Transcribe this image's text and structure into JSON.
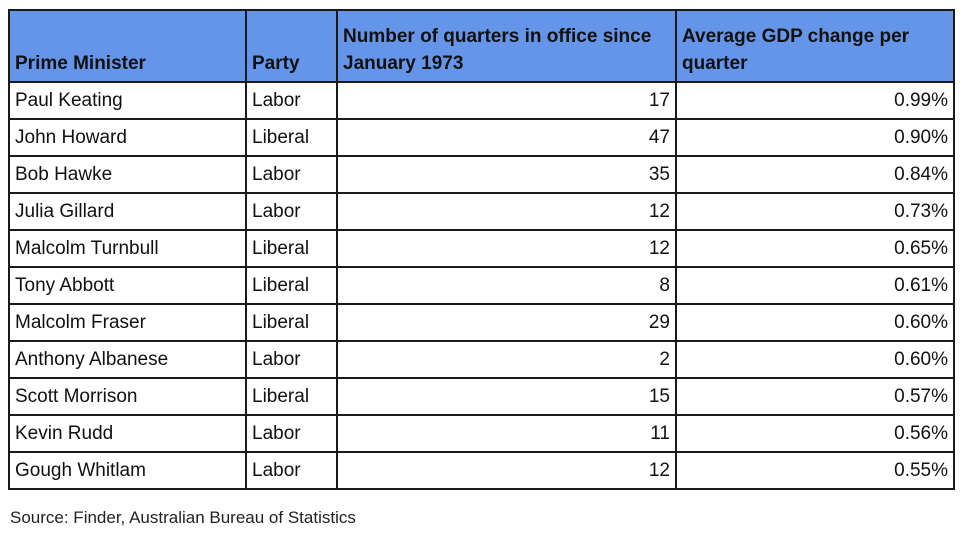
{
  "table": {
    "headers": [
      "Prime Minister",
      "Party",
      "Number of quarters in office since January 1973",
      "Average GDP change per quarter"
    ],
    "header_color": "#6495e8",
    "rows": [
      {
        "pm": "Paul Keating",
        "party": "Labor",
        "quarters": "17",
        "gdp": "0.99%"
      },
      {
        "pm": "John Howard",
        "party": "Liberal",
        "quarters": "47",
        "gdp": "0.90%"
      },
      {
        "pm": "Bob Hawke",
        "party": "Labor",
        "quarters": "35",
        "gdp": "0.84%"
      },
      {
        "pm": "Julia Gillard",
        "party": "Labor",
        "quarters": "12",
        "gdp": "0.73%"
      },
      {
        "pm": "Malcolm Turnbull",
        "party": "Liberal",
        "quarters": "12",
        "gdp": "0.65%"
      },
      {
        "pm": "Tony Abbott",
        "party": "Liberal",
        "quarters": "8",
        "gdp": "0.61%"
      },
      {
        "pm": "Malcolm Fraser",
        "party": "Liberal",
        "quarters": "29",
        "gdp": "0.60%"
      },
      {
        "pm": "Anthony Albanese",
        "party": "Labor",
        "quarters": "2",
        "gdp": "0.60%"
      },
      {
        "pm": "Scott Morrison",
        "party": "Liberal",
        "quarters": "15",
        "gdp": "0.57%"
      },
      {
        "pm": "Kevin Rudd",
        "party": "Labor",
        "quarters": "11",
        "gdp": "0.56%"
      },
      {
        "pm": "Gough Whitlam",
        "party": "Labor",
        "quarters": "12",
        "gdp": "0.55%"
      }
    ]
  },
  "source": "Source: Finder, Australian Bureau of Statistics"
}
